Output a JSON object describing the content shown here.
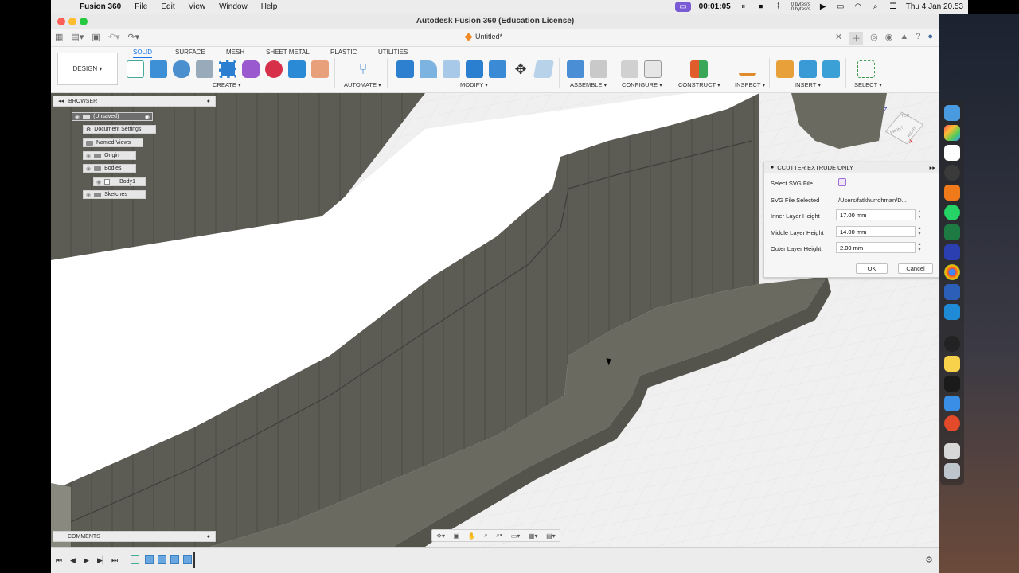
{
  "menubar": {
    "app_name": "Fusion 360",
    "items": [
      "File",
      "Edit",
      "View",
      "Window",
      "Help"
    ],
    "timer": "00:01:05",
    "net_up": "0 bytes/s",
    "net_down": "0 bytes/s",
    "clock": "Thu 4 Jan  20.53"
  },
  "window": {
    "title": "Autodesk Fusion 360 (Education License)",
    "doc_tab": "Untitled*"
  },
  "ribbon": {
    "design_label": "DESIGN ▾",
    "tabs": [
      "SOLID",
      "SURFACE",
      "MESH",
      "SHEET METAL",
      "PLASTIC",
      "UTILITIES"
    ],
    "active_tab": "SOLID",
    "groups": [
      "CREATE ▾",
      "AUTOMATE ▾",
      "MODIFY ▾",
      "ASSEMBLE ▾",
      "CONFIGURE ▾",
      "CONSTRUCT ▾",
      "INSPECT ▾",
      "INSERT ▾",
      "SELECT ▾"
    ]
  },
  "browser": {
    "title": "BROWSER",
    "nodes": [
      "(Unsaved)",
      "Document Settings",
      "Named Views",
      "Origin",
      "Bodies",
      "Body1",
      "Sketches"
    ]
  },
  "dialog": {
    "title": "CCUTTER EXTRUDE ONLY",
    "select_svg_label": "Select SVG File",
    "svg_selected_label": "SVG File Selected",
    "svg_selected_value": "/Users/fatkhurrohman/D...",
    "inner_label": "Inner Layer Height",
    "inner_value": "17.00 mm",
    "middle_label": "Middle Layer Height",
    "middle_value": "14.00 mm",
    "outer_label": "Outer Layer Height",
    "outer_value": "2.00 mm",
    "ok_label": "OK",
    "cancel_label": "Cancel"
  },
  "comments": {
    "title": "COMMENTS"
  },
  "viewcube": {
    "top": "TOP",
    "front": "FRONT",
    "right": "RIGHT"
  },
  "colors": {
    "accent": "#1a73e8",
    "model_dark": "#6b6a60",
    "model_wall": "#5a5951",
    "grid_bg": "#f0f0f0"
  }
}
